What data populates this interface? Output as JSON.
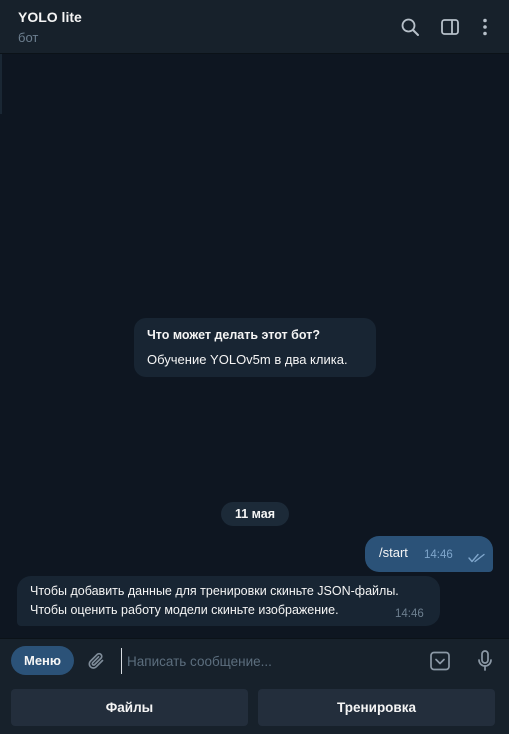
{
  "header": {
    "title": "YOLO lite",
    "subtitle": "бот",
    "icons": [
      "search-icon",
      "sidebar-toggle-icon",
      "more-vertical-icon"
    ]
  },
  "chat": {
    "bot_info": {
      "title": "Что может делать этот бот?",
      "text": "Обучение YOLOv5m в два клика."
    },
    "date_separator": "11 мая",
    "messages": [
      {
        "direction": "outgoing",
        "text": "/start",
        "time": "14:46",
        "status": "read"
      },
      {
        "direction": "incoming",
        "lines": [
          "Чтобы добавить данные для тренировки скиньте JSON-файлы.",
          "Чтобы оценить работу модели скиньте изображение."
        ],
        "time": "14:46"
      }
    ]
  },
  "composer": {
    "menu_label": "Меню",
    "placeholder": "Написать сообщение...",
    "value": "",
    "icons": [
      "attach-icon",
      "bot-keyboard-icon",
      "microphone-icon"
    ]
  },
  "reply_keyboard": {
    "buttons": [
      "Файлы",
      "Тренировка"
    ]
  },
  "colors": {
    "background": "#0e1621",
    "panel": "#17212b",
    "incoming_bubble": "#182533",
    "outgoing_bubble": "#2b5278",
    "accent": "#2b5278",
    "muted_text": "#6d7f8f",
    "read_ticks": "#7fa6cc"
  }
}
